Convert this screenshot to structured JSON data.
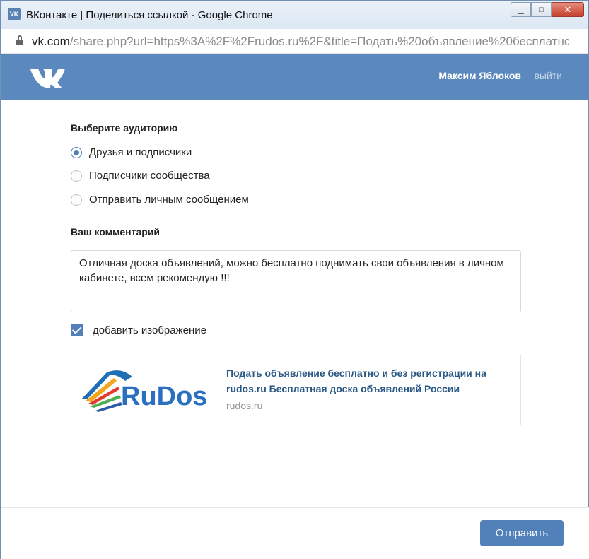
{
  "window": {
    "title": "ВКонтакте | Поделиться ссылкой - Google Chrome",
    "favicon": "vk-icon",
    "min_glyph": "▁",
    "max_glyph": "□",
    "close_glyph": "✕"
  },
  "address": {
    "host": "vk.com",
    "path": "/share.php?url=https%3A%2F%2Frudos.ru%2F&title=Подать%20объявление%20бесплатно"
  },
  "header": {
    "user_name": "Максим Яблоков",
    "logout_label": "выйти"
  },
  "audience": {
    "title": "Выберите аудиторию",
    "options": [
      {
        "label": "Друзья и подписчики",
        "checked": true
      },
      {
        "label": "Подписчики сообщества",
        "checked": false
      },
      {
        "label": "Отправить личным сообщением",
        "checked": false
      }
    ]
  },
  "comment": {
    "title": "Ваш комментарий",
    "value": "Отличная доска объявлений, можно бесплатно поднимать свои объявления в личном кабинете, всем рекомендую !!!"
  },
  "add_image": {
    "label": "добавить изображение",
    "checked": true
  },
  "link_preview": {
    "logo_text": "RuDos",
    "title": "Подать объявление бесплатно и без регистрации на rudos.ru Бесплатная доска объявлений России",
    "domain": "rudos.ru"
  },
  "footer": {
    "send_label": "Отправить"
  },
  "colors": {
    "vk_header": "#5b88bd",
    "accent": "#5181b8",
    "link": "#2a5885"
  }
}
